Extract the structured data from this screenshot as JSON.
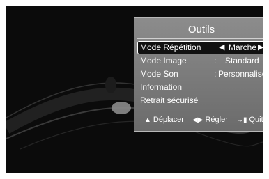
{
  "menu": {
    "title": "Outils",
    "items": [
      {
        "label": "Mode Répétition",
        "value": "Marche",
        "selected": true
      },
      {
        "label": "Mode Image",
        "sep": ":",
        "value": "Standard"
      },
      {
        "label": "Mode Son",
        "sep": ":",
        "value": "Personnalisé"
      },
      {
        "label": "Information"
      },
      {
        "label": "Retrait sécurisé"
      }
    ]
  },
  "footer": {
    "move_label": "Déplacer",
    "adjust_label": "Régler",
    "quit_label": "Quitter"
  },
  "icons": {
    "move": "up-down-arrows-icon",
    "adjust": "left-right-arrows-icon",
    "quit": "exit-icon"
  },
  "colors": {
    "screen_background": "#0b0b0b",
    "panel_background": "#7a7a7a",
    "selected_row": "#111111",
    "text": "#ffffff"
  }
}
